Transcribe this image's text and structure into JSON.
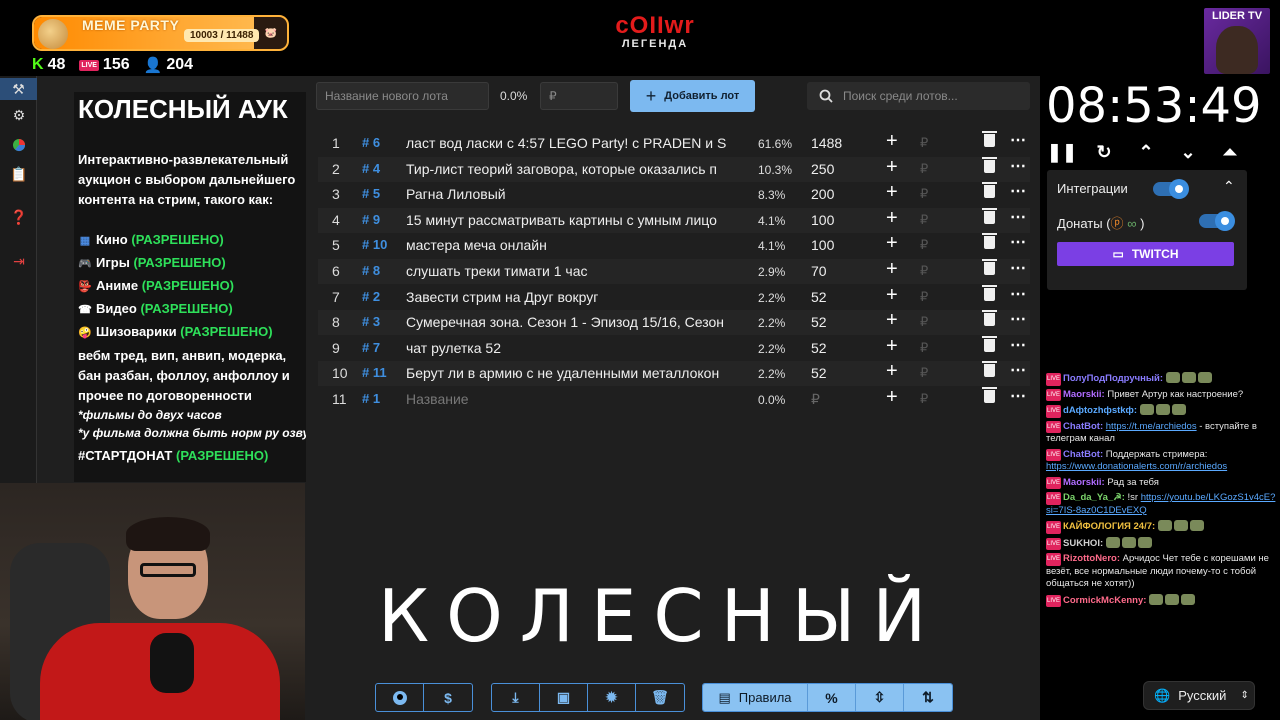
{
  "overlay": {
    "badge_name": "MEME PARTY",
    "badge_count": "10003 / 11488",
    "badge_fill_fraction": 0.87,
    "kick_viewers": "48",
    "live_viewers": "156",
    "total_viewers": "204",
    "brand_logo": "cOIIwr",
    "brand_sub": "ЛЕГЕНДА",
    "lider_label": "LIDER TV"
  },
  "rules": {
    "title": "КОЛЕСНЫЙ АУК",
    "description": "Интерактивно-развлекательный аукцион с выбором дальнейшего контента на стрим, такого как:",
    "items": [
      {
        "label": "Кино",
        "status": "(РАЗРЕШЕНО)"
      },
      {
        "label": "Игры",
        "status": "(РАЗРЕШЕНО)"
      },
      {
        "label": "Аниме",
        "status": "(РАЗРЕШЕНО)"
      },
      {
        "label": "Видео",
        "status": "(РАЗРЕШЕНО)"
      },
      {
        "label": "Шизоварики",
        "status": "(РАЗРЕШЕНО)"
      }
    ],
    "extra": "вебм тред, вип, анвип, модерка, бан разбан, фоллоу, анфоллоу и прочее по договоренности",
    "note1": "*фильмы до двух часов",
    "note2": "*у фильма должна быть норм ру озвуч",
    "start_label": "#СТАРТДОНАТ",
    "start_status": "(РАЗРЕШЕНО)"
  },
  "toolbar": {
    "new_lot_placeholder": "Название нового лота",
    "percent": "0.0%",
    "amount_placeholder": "₽",
    "add_button": "Добавить лот",
    "search_placeholder": "Поиск среди лотов..."
  },
  "lots": [
    {
      "n": "1",
      "id": "# 6",
      "title": "ласт вод ласки с 4:57 LEGO Party! с PRADEN и S",
      "pct": "61.6%",
      "amount": "1488"
    },
    {
      "n": "2",
      "id": "# 4",
      "title": "Тир-лист теорий заговора, которые оказались п",
      "pct": "10.3%",
      "amount": "250"
    },
    {
      "n": "3",
      "id": "# 5",
      "title": "Рагна Лиловый",
      "pct": "8.3%",
      "amount": "200"
    },
    {
      "n": "4",
      "id": "# 9",
      "title": "15 минут рассматривать картины с умным лицо",
      "pct": "4.1%",
      "amount": "100"
    },
    {
      "n": "5",
      "id": "# 10",
      "title": " мастера меча онлайн",
      "pct": "4.1%",
      "amount": "100"
    },
    {
      "n": "6",
      "id": "# 8",
      "title": "слушать треки тимати 1 час",
      "pct": "2.9%",
      "amount": "70"
    },
    {
      "n": "7",
      "id": "# 2",
      "title": "Завести стрим на Друг вокруг",
      "pct": "2.2%",
      "amount": "52"
    },
    {
      "n": "8",
      "id": "# 3",
      "title": "Сумеречная зона. Сезон 1 - Эпизод 15/16, Сезон",
      "pct": "2.2%",
      "amount": "52"
    },
    {
      "n": "9",
      "id": "# 7",
      "title": "чат рулетка 52",
      "pct": "2.2%",
      "amount": "52"
    },
    {
      "n": "10",
      "id": "# 11",
      "title": " Берут ли в армию с не удаленными металлокон",
      "pct": "2.2%",
      "amount": "52"
    },
    {
      "n": "11",
      "id": "# 1",
      "title": "Название",
      "pct": "0.0%",
      "amount": "₽"
    }
  ],
  "big_word": "КОЛЕСНЫЙ",
  "bottom": {
    "rules_button": "Правила",
    "percent_button": "%"
  },
  "timer": {
    "time": "08:53:49"
  },
  "integrations": {
    "label": "Интеграции",
    "donations_label": "Донаты (",
    "donations_close": ")",
    "twitch_button": "TWITCH"
  },
  "chat": [
    {
      "nick": "ПолуПодПодручный:",
      "nick_color": "#8a7cff",
      "text": ""
    },
    {
      "nick": "Maorskii:",
      "nick_color": "#b06cff",
      "text": "Привет Артур как настроение?"
    },
    {
      "nick": "dAфtozhфstkф:",
      "nick_color": "#5aa9ff",
      "text": ""
    },
    {
      "nick": "ChatBot:",
      "nick_color": "#8a7cff",
      "text": "",
      "link": "https://t.me/archiedos",
      "after": " - вступайте в телеграм канал"
    },
    {
      "nick": "ChatBot:",
      "nick_color": "#8a7cff",
      "text": "Поддержать стримера: ",
      "link": "https://www.donationalerts.com/r/archiedos",
      "after": ""
    },
    {
      "nick": "Maorskii:",
      "nick_color": "#b06cff",
      "text": "Рад за тебя"
    },
    {
      "nick": "Da_da_Ya_☭:",
      "nick_color": "#7bd36b",
      "text": "!sr ",
      "link": "https://youtu.be/LKGozS1v4cE?si=7IS-8az0C1DEvEXQ",
      "after": ""
    },
    {
      "nick": "КАЙФОЛОГИЯ 24/7:",
      "nick_color": "#f0c040",
      "text": ""
    },
    {
      "nick": "SUKHOI:",
      "nick_color": "#d0d0d0",
      "text": ""
    },
    {
      "nick": "RizottoNero:",
      "nick_color": "#ff6b8b",
      "text": "Арчидос Чет тебе с корешами не везёт, все нормальные люди почему-то с тобой общаться не хотят))",
      "bold_prefix": "Арчидос"
    },
    {
      "nick": "CormickMcKenny:",
      "nick_color": "#ff6b8b",
      "text": ""
    }
  ],
  "language": {
    "selected": "Русский"
  },
  "colors": {
    "accent": "#7cb9f0",
    "allowed": "#2ee05a",
    "twitch": "#7b3fe4",
    "brand_red": "#e31b1b"
  }
}
